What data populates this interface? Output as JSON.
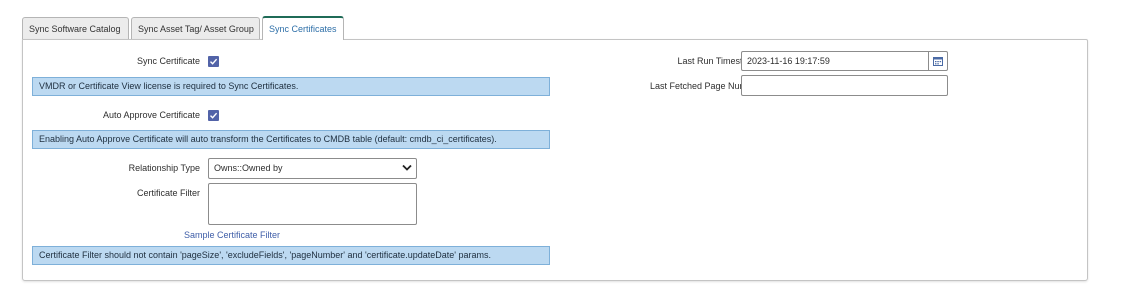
{
  "tabs": [
    {
      "label": "Sync Software Catalog",
      "active": false
    },
    {
      "label": "Sync Asset Tag/ Asset Group",
      "active": false
    },
    {
      "label": "Sync Certificates",
      "active": true
    }
  ],
  "form": {
    "sync_certificate": {
      "label": "Sync Certificate",
      "checked": true
    },
    "sync_info": "VMDR or Certificate View license is required to Sync Certificates.",
    "auto_approve": {
      "label": "Auto Approve Certificate",
      "checked": true
    },
    "auto_approve_info": "Enabling Auto Approve Certificate will auto transform the Certificates to CMDB table (default: cmdb_ci_certificates).",
    "relationship_type": {
      "label": "Relationship Type",
      "selected": "Owns::Owned by"
    },
    "certificate_filter": {
      "label": "Certificate Filter",
      "value": ""
    },
    "sample_link": "Sample Certificate Filter",
    "filter_info": "Certificate Filter should not contain 'pageSize', 'excludeFields', 'pageNumber' and 'certificate.updateDate' params.",
    "last_run": {
      "label": "Last Run Timestamp",
      "value": "2023-11-16 19:17:59"
    },
    "last_fetched": {
      "label": "Last Fetched Page Number",
      "value": ""
    }
  },
  "colors": {
    "active_tab_border": "#1f6b57",
    "info_bg": "#bcd9f1",
    "checkbox": "#5263a8",
    "link": "#3f5ea8"
  }
}
